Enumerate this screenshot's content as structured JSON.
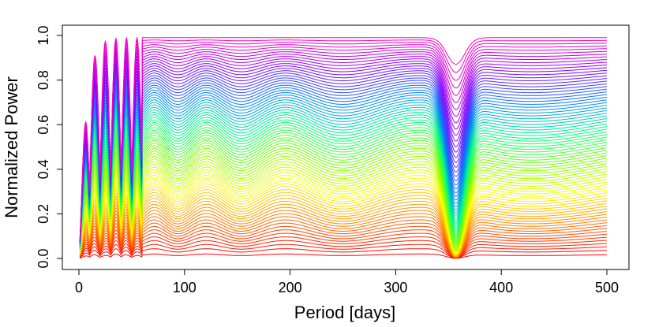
{
  "chart_data": {
    "type": "line",
    "title": "",
    "xlabel": "Period [days]",
    "ylabel": "Normalized Power",
    "xlim": [
      0,
      500
    ],
    "ylim": [
      0,
      1
    ],
    "xticks": [
      0,
      100,
      200,
      300,
      400,
      500
    ],
    "xtick_labels": [
      "0",
      "100",
      "200",
      "300",
      "400",
      "500"
    ],
    "yticks": [
      0.0,
      0.2,
      0.4,
      0.6,
      0.8,
      1.0
    ],
    "ytick_labels": [
      "0.0",
      "0.2",
      "0.4",
      "0.6",
      "0.8",
      "1.0"
    ],
    "grid": false,
    "legend": "none",
    "palette": "rainbow",
    "curve_count": 80,
    "x_start": 1,
    "x_end": 500,
    "dip_center_period": 357,
    "series_color_order": [
      "#ff0000",
      "#ff8000",
      "#ffff00",
      "#80ff00",
      "#00ff80",
      "#0080ff",
      "#8000ff",
      "#ff00bf"
    ],
    "reference_series": [
      {
        "name": "",
        "x": [
          1,
          10,
          20,
          40,
          60,
          80,
          100,
          150,
          200,
          250,
          300,
          340,
          357,
          380,
          420,
          460,
          500
        ],
        "y": [
          0.0,
          0.02,
          0.02,
          0.02,
          0.02,
          0.02,
          0.02,
          0.02,
          0.02,
          0.02,
          0.02,
          0.02,
          0.01,
          0.02,
          0.02,
          0.02,
          0.02
        ]
      },
      {
        "name": "",
        "x": [
          1,
          10,
          20,
          40,
          60,
          80,
          100,
          150,
          200,
          250,
          300,
          340,
          357,
          380,
          420,
          460,
          500
        ],
        "y": [
          0.0,
          0.95,
          0.99,
          0.98,
          0.98,
          0.98,
          0.98,
          0.98,
          0.98,
          0.98,
          0.98,
          0.98,
          0.86,
          0.97,
          0.98,
          0.98,
          0.99
        ]
      }
    ]
  }
}
